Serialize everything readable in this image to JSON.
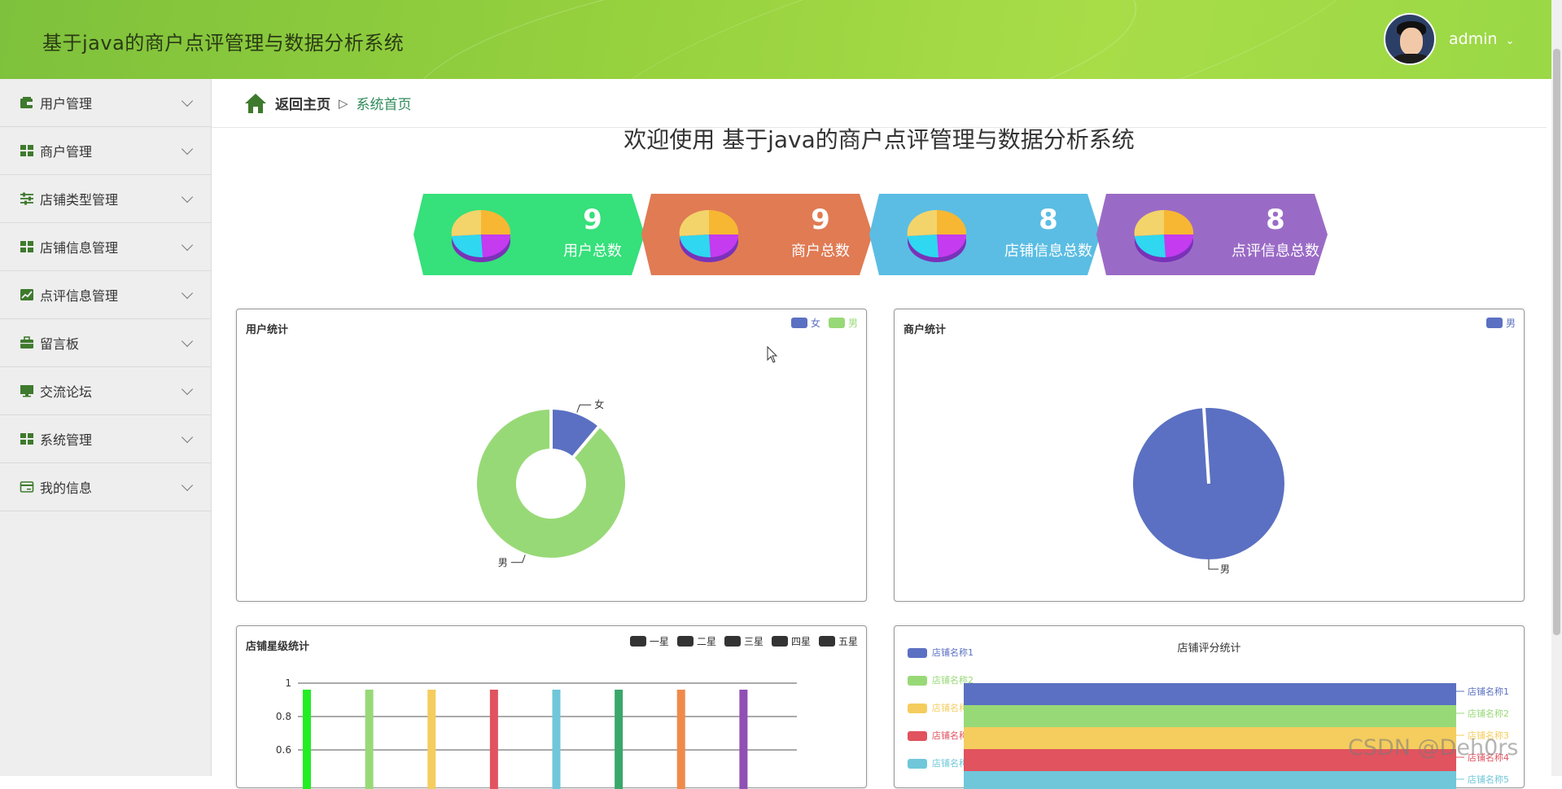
{
  "header": {
    "title": "基于java的商户点评管理与数据分析系统",
    "user": "admin"
  },
  "sidebar": {
    "items": [
      {
        "label": "用户管理",
        "icon": "wallet-icon"
      },
      {
        "label": "商户管理",
        "icon": "grid-icon"
      },
      {
        "label": "店铺类型管理",
        "icon": "sliders-icon"
      },
      {
        "label": "店铺信息管理",
        "icon": "grid-icon"
      },
      {
        "label": "点评信息管理",
        "icon": "chart-line-icon"
      },
      {
        "label": "留言板",
        "icon": "briefcase-icon"
      },
      {
        "label": "交流论坛",
        "icon": "monitor-icon"
      },
      {
        "label": "系统管理",
        "icon": "grid-icon"
      },
      {
        "label": "我的信息",
        "icon": "card-icon"
      }
    ]
  },
  "breadcrumb": {
    "home": "返回主页",
    "separator": "▷",
    "current": "系统首页"
  },
  "welcome": "欢迎使用 基于java的商户点评管理与数据分析系统",
  "stats": [
    {
      "value": "9",
      "label": "用户总数",
      "color": "#36e07a"
    },
    {
      "value": "9",
      "label": "商户总数",
      "color": "#e07b54"
    },
    {
      "value": "8",
      "label": "店铺信息总数",
      "color": "#5bbde3"
    },
    {
      "value": "8",
      "label": "点评信息总数",
      "color": "#9a6bc6"
    }
  ],
  "colors": {
    "primary": "#5b70c2",
    "secondary": "#98d977",
    "header_green": "#9ad845"
  },
  "panels": {
    "user_stats": {
      "title": "用户统计"
    },
    "merchant_stats": {
      "title": "商户统计"
    },
    "shop_star_stats": {
      "title": "店铺星级统计"
    },
    "shop_score_stats": {
      "title": "店铺评分统计"
    }
  },
  "chart_data": [
    {
      "type": "pie",
      "title": "用户统计",
      "donut": true,
      "legend": [
        "女",
        "男"
      ],
      "labels": [
        "女",
        "男"
      ],
      "values": [
        1,
        8
      ],
      "colors": [
        "#5b70c2",
        "#98d977"
      ]
    },
    {
      "type": "pie",
      "title": "商户统计",
      "legend": [
        "男"
      ],
      "labels": [
        "男"
      ],
      "values": [
        9
      ],
      "colors": [
        "#5b70c2"
      ]
    },
    {
      "type": "bar",
      "title": "店铺星级统计",
      "legend": [
        "一星",
        "二星",
        "三星",
        "四星",
        "五星"
      ],
      "yticks": [
        "1",
        "0.8",
        "0.6"
      ],
      "ylim": [
        0,
        1
      ],
      "values": [
        1,
        1,
        1,
        1,
        1,
        1,
        1,
        1
      ],
      "colors": [
        "#22ee22",
        "#98d977",
        "#f5cd5e",
        "#e0535f",
        "#6fc7d9",
        "#3aa76b",
        "#f08a4b",
        "#9050b5"
      ]
    },
    {
      "type": "area",
      "title": "店铺评分统计",
      "legend": [
        "店铺名称1",
        "店铺名称2",
        "店铺名称3",
        "店铺名称4",
        "店铺名称5"
      ],
      "series": [
        {
          "name": "店铺名称1",
          "color": "#5b70c2"
        },
        {
          "name": "店铺名称2",
          "color": "#98d977"
        },
        {
          "name": "店铺名称3",
          "color": "#f5cd5e"
        },
        {
          "name": "店铺名称4",
          "color": "#e0535f"
        },
        {
          "name": "店铺名称5",
          "color": "#6fc7d9"
        }
      ]
    }
  ],
  "watermark": "CSDN @Deh0rs"
}
